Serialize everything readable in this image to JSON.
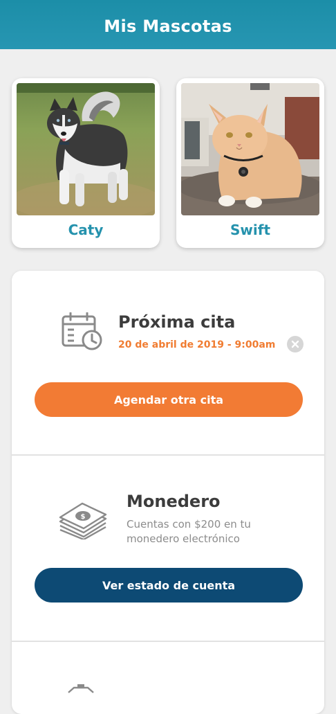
{
  "header": {
    "title": "Mis Mascotas",
    "background_color": "#2592ad"
  },
  "pets": [
    {
      "name": "Caty",
      "photo_icon": "husky-dog-photo"
    },
    {
      "name": "Swift",
      "photo_icon": "orange-cat-photo"
    }
  ],
  "appointment": {
    "icon": "calendar-clock-icon",
    "title": "Próxima cita",
    "date": "20 de abril de 2019 - 9:00am",
    "clear_icon": "close-circle-icon",
    "button_label": "Agendar otra cita",
    "accent_color": "#f27b34"
  },
  "wallet": {
    "icon": "money-stack-icon",
    "title": "Monedero",
    "description": "Cuentas con $200 en tu monedero electrónico",
    "button_label": "Ver estado de cuenta",
    "button_color": "#0d4a74"
  },
  "next_section": {
    "icon": "partially-visible-icon"
  }
}
